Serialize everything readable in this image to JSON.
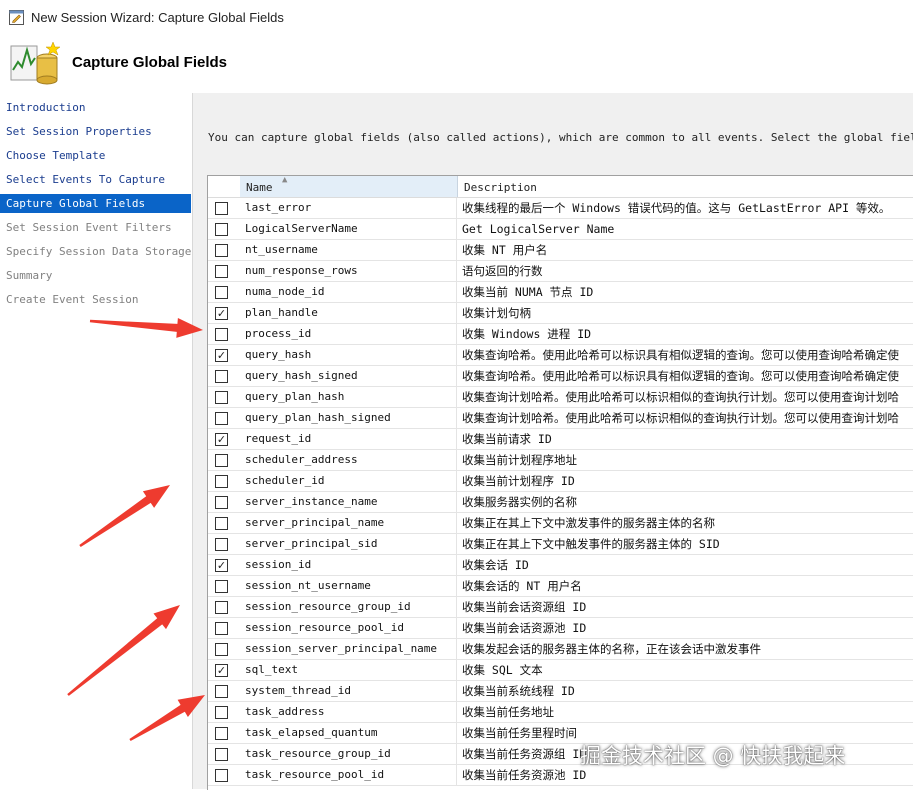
{
  "window": {
    "title": "New Session Wizard: Capture Global Fields"
  },
  "header": {
    "heading": "Capture Global Fields"
  },
  "nav": {
    "items": [
      {
        "label": "Introduction",
        "state": "link"
      },
      {
        "label": "Set Session Properties",
        "state": "link"
      },
      {
        "label": "Choose Template",
        "state": "link"
      },
      {
        "label": "Select Events To Capture",
        "state": "link"
      },
      {
        "label": "Capture Global Fields",
        "state": "active"
      },
      {
        "label": "Set Session Event Filters",
        "state": "disabled"
      },
      {
        "label": "Specify Session Data Storage",
        "state": "disabled"
      },
      {
        "label": "Summary",
        "state": "disabled"
      },
      {
        "label": "Create Event Session",
        "state": "disabled"
      }
    ]
  },
  "content": {
    "intro": "You can capture global fields (also called actions), which are common to all events. Select the global fields you want"
  },
  "grid": {
    "columns": {
      "name": "Name",
      "description": "Description"
    },
    "sort_icon": "sort-ascending-icon",
    "rows": [
      {
        "checked": false,
        "name": "last_error",
        "description": "收集线程的最后一个 Windows 错误代码的值。这与 GetLastError API 等效。"
      },
      {
        "checked": false,
        "name": "LogicalServerName",
        "description": "Get LogicalServer Name"
      },
      {
        "checked": false,
        "name": "nt_username",
        "description": "收集 NT 用户名"
      },
      {
        "checked": false,
        "name": "num_response_rows",
        "description": "语句返回的行数"
      },
      {
        "checked": false,
        "name": "numa_node_id",
        "description": "收集当前 NUMA 节点 ID"
      },
      {
        "checked": true,
        "name": "plan_handle",
        "description": "收集计划句柄"
      },
      {
        "checked": false,
        "name": "process_id",
        "description": "收集 Windows 进程 ID"
      },
      {
        "checked": true,
        "name": "query_hash",
        "description": "收集查询哈希。使用此哈希可以标识具有相似逻辑的查询。您可以使用查询哈希确定使"
      },
      {
        "checked": false,
        "name": "query_hash_signed",
        "description": "收集查询哈希。使用此哈希可以标识具有相似逻辑的查询。您可以使用查询哈希确定使"
      },
      {
        "checked": false,
        "name": "query_plan_hash",
        "description": "收集查询计划哈希。使用此哈希可以标识相似的查询执行计划。您可以使用查询计划哈"
      },
      {
        "checked": false,
        "name": "query_plan_hash_signed",
        "description": "收集查询计划哈希。使用此哈希可以标识相似的查询执行计划。您可以使用查询计划哈"
      },
      {
        "checked": true,
        "name": "request_id",
        "description": "收集当前请求 ID"
      },
      {
        "checked": false,
        "name": "scheduler_address",
        "description": "收集当前计划程序地址"
      },
      {
        "checked": false,
        "name": "scheduler_id",
        "description": "收集当前计划程序 ID"
      },
      {
        "checked": false,
        "name": "server_instance_name",
        "description": "收集服务器实例的名称"
      },
      {
        "checked": false,
        "name": "server_principal_name",
        "description": "收集正在其上下文中激发事件的服务器主体的名称"
      },
      {
        "checked": false,
        "name": "server_principal_sid",
        "description": "收集正在其上下文中触发事件的服务器主体的 SID"
      },
      {
        "checked": true,
        "name": "session_id",
        "description": "收集会话 ID"
      },
      {
        "checked": false,
        "name": "session_nt_username",
        "description": "收集会话的 NT 用户名"
      },
      {
        "checked": false,
        "name": "session_resource_group_id",
        "description": "收集当前会话资源组 ID"
      },
      {
        "checked": false,
        "name": "session_resource_pool_id",
        "description": "收集当前会话资源池 ID"
      },
      {
        "checked": false,
        "name": "session_server_principal_name",
        "description": "收集发起会话的服务器主体的名称，正在该会话中激发事件"
      },
      {
        "checked": true,
        "name": "sql_text",
        "description": "收集 SQL 文本"
      },
      {
        "checked": false,
        "name": "system_thread_id",
        "description": "收集当前系统线程 ID"
      },
      {
        "checked": false,
        "name": "task_address",
        "description": "收集当前任务地址"
      },
      {
        "checked": false,
        "name": "task_elapsed_quantum",
        "description": "收集当前任务里程时间"
      },
      {
        "checked": false,
        "name": "task_resource_group_id",
        "description": "收集当前任务资源组 ID"
      },
      {
        "checked": false,
        "name": "task_resource_pool_id",
        "description": "收集当前任务资源池 ID"
      }
    ]
  },
  "annotation": {
    "arrow_color": "#ee3b2f"
  },
  "watermark": "掘金技术社区 @ 快扶我起来",
  "colors": {
    "nav_active_bg": "#0a64c8",
    "nav_link": "#1a3c8e",
    "content_bg": "#f0f0f0",
    "header_col_bg": "#e3eef8"
  }
}
